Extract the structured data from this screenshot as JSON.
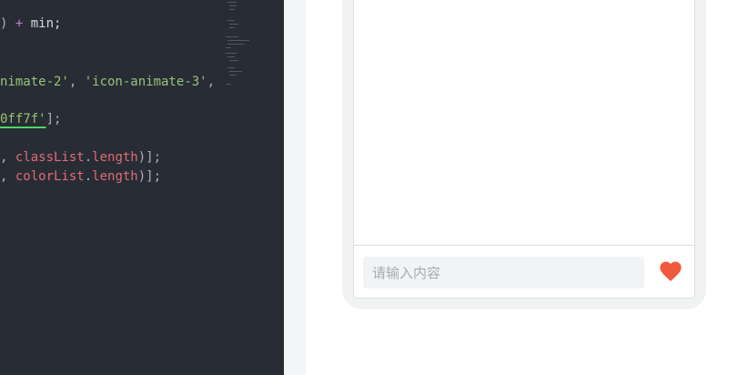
{
  "editor": {
    "lines": [
      [
        {
          "t": ") ",
          "c": "tok-punc"
        },
        {
          "t": "+",
          "c": "tok-op"
        },
        {
          "t": " min;",
          "c": "tok-plain"
        }
      ],
      [
        {
          "t": "nimate-2'",
          "c": "tok-str"
        },
        {
          "t": ", ",
          "c": "tok-punc"
        },
        {
          "t": "'icon-animate-3'",
          "c": "tok-str"
        },
        {
          "t": ",",
          "c": "tok-punc"
        }
      ],
      [
        {
          "t": "0ff7f'",
          "c": "tok-str underline-str"
        },
        {
          "t": "];",
          "c": "tok-punc"
        }
      ],
      [
        {
          "t": ", ",
          "c": "tok-punc"
        },
        {
          "t": "classList",
          "c": "tok-prop"
        },
        {
          "t": ".",
          "c": "tok-punc"
        },
        {
          "t": "length",
          "c": "tok-prop"
        },
        {
          "t": ")];",
          "c": "tok-punc"
        }
      ],
      [
        {
          "t": ", ",
          "c": "tok-punc"
        },
        {
          "t": "colorList",
          "c": "tok-prop"
        },
        {
          "t": ".",
          "c": "tok-punc"
        },
        {
          "t": "length",
          "c": "tok-prop"
        },
        {
          "t": ")];",
          "c": "tok-punc"
        }
      ]
    ]
  },
  "preview": {
    "input_placeholder": "请输入内容",
    "input_value": "",
    "send_icon": "heart-icon",
    "heart_color": "#f05a3c"
  }
}
